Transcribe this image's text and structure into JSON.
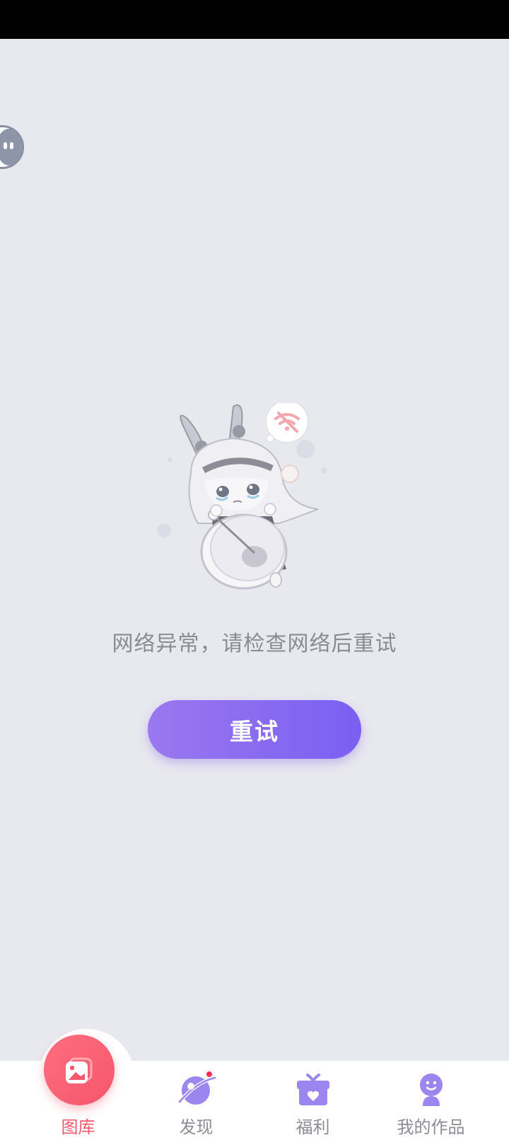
{
  "main": {
    "error_message": "网络异常，请检查网络后重试",
    "retry_label": "重试"
  },
  "tabbar": {
    "tabs": [
      {
        "label": "图库",
        "icon": "gallery-icon",
        "active": true
      },
      {
        "label": "发现",
        "icon": "planet-icon",
        "active": false,
        "badge": true
      },
      {
        "label": "福利",
        "icon": "gift-icon",
        "active": false
      },
      {
        "label": "我的作品",
        "icon": "profile-icon",
        "active": false
      }
    ]
  },
  "colors": {
    "background": "#e8e8ef",
    "accent_purple": "#8a6cf0",
    "active_tab": "#f05a6e",
    "inactive_tab": "#8d8d96"
  }
}
